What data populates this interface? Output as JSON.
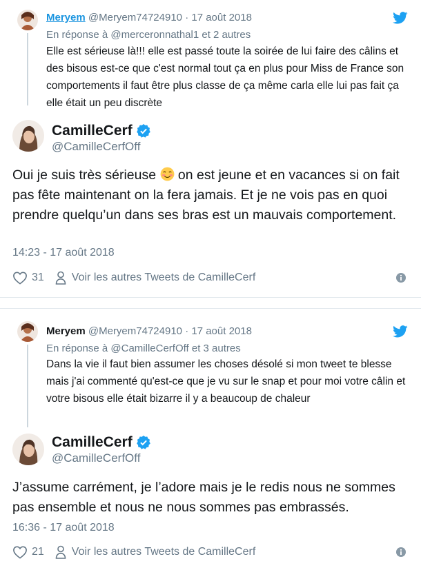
{
  "colors": {
    "link": "#1b95e0",
    "muted": "#657786",
    "text": "#14171a",
    "line": "#ccd6dd",
    "twitter": "#1da1f2"
  },
  "embeds": [
    {
      "parent": {
        "name": "Meryem",
        "handle": "@Meryem74724910",
        "dot": "·",
        "date": "17 août 2018",
        "reply_to": "En réponse à @merceronnathal1 et 2 autres",
        "text": "Elle est sérieuse là!!! elle est passé toute la soirée de lui faire des câlins et des bisous est-ce que c'est normal tout ça en plus pour Miss de France son comportements il faut être plus classe de ça même carla elle lui pas fait ça elle était un peu discrète"
      },
      "main": {
        "name": "CamilleCerf",
        "handle": "@CamilleCerfOff",
        "text_before_emoji": "Oui je suis très sérieuse ",
        "text_after_emoji": " on est jeune et en vacances si on fait pas fête maintenant on la fera jamais. Et je ne vois pas en quoi prendre quelqu’un dans ses bras est un mauvais comportement.",
        "timestamp": "14:23 - 17 août 2018",
        "likes": "31",
        "see_more": "Voir les autres Tweets de CamilleCerf"
      }
    },
    {
      "parent": {
        "name": "Meryem",
        "handle": "@Meryem74724910",
        "dot": "·",
        "date": "17 août 2018",
        "reply_to": "En réponse à @CamilleCerfOff et 3 autres",
        "text": "Dans la vie il faut bien assumer les choses désolé si mon tweet te blesse mais j'ai commenté qu'est-ce que je vu sur le snap et pour moi votre câlin et votre bisous elle était bizarre il y a beaucoup de chaleur"
      },
      "main": {
        "name": "CamilleCerf",
        "handle": "@CamilleCerfOff",
        "text": "J’assume carrément, je l’adore mais je le redis nous ne sommes pas ensemble et nous ne nous sommes pas embrassés.",
        "timestamp": "16:36 - 17 août 2018",
        "likes": "21",
        "see_more": "Voir les autres Tweets de CamilleCerf"
      }
    }
  ],
  "icons": {
    "avatar": "avatar-icon",
    "bird": "twitter-bird-icon",
    "verified": "verified-badge-icon",
    "emoji": "smiling-face-emoji",
    "heart": "heart-icon",
    "person": "person-icon",
    "info": "info-icon"
  }
}
